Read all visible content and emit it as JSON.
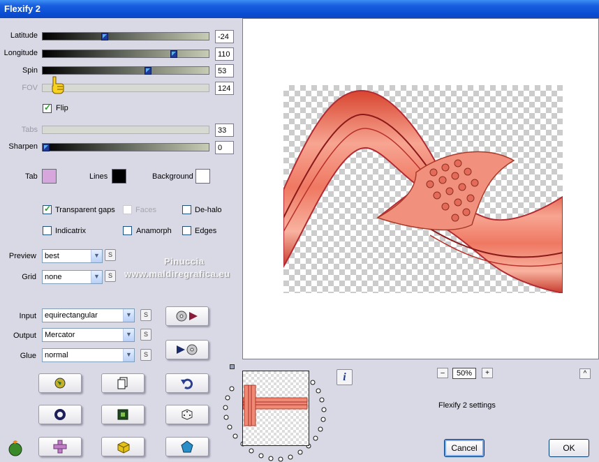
{
  "window": {
    "title": "Flexify 2"
  },
  "sliders": [
    {
      "label": "Latitude",
      "value": "-24",
      "thumb_pct": 0.37,
      "enabled": true
    },
    {
      "label": "Longitude",
      "value": "110",
      "thumb_pct": 0.78,
      "enabled": true
    },
    {
      "label": "Spin",
      "value": "53",
      "thumb_pct": 0.62,
      "enabled": true
    },
    {
      "label": "FOV",
      "value": "124",
      "thumb_pct": 0.05,
      "enabled": false
    }
  ],
  "flip": {
    "label": "Flip",
    "checked": true
  },
  "tabs_slider": {
    "label": "Tabs",
    "value": "33",
    "enabled": false
  },
  "sharpen_slider": {
    "label": "Sharpen",
    "value": "0",
    "thumb_pct": 0.0
  },
  "colors": {
    "tab": {
      "label": "Tab",
      "color": "#d6a6dc"
    },
    "lines": {
      "label": "Lines",
      "color": "#000000"
    },
    "background": {
      "label": "Background",
      "color": "#ffffff"
    }
  },
  "options": {
    "transparent_gaps": {
      "label": "Transparent gaps",
      "checked": true
    },
    "faces": {
      "label": "Faces",
      "checked": false
    },
    "de_halo": {
      "label": "De-halo",
      "checked": false
    },
    "indicatrix": {
      "label": "Indicatrix",
      "checked": false
    },
    "anamorph": {
      "label": "Anamorph",
      "checked": false
    },
    "edges": {
      "label": "Edges",
      "checked": false
    }
  },
  "preview_select": {
    "label": "Preview",
    "value": "best"
  },
  "grid_select": {
    "label": "Grid",
    "value": "none"
  },
  "input_select": {
    "label": "Input",
    "value": "equirectangular"
  },
  "output_select": {
    "label": "Output",
    "value": "Mercator"
  },
  "glue_select": {
    "label": "Glue",
    "value": "normal"
  },
  "small_button_label": "S",
  "zoom": {
    "value": "50%",
    "minus": "–",
    "plus": "+"
  },
  "settings_label": "Flexify 2 settings",
  "collapse_label": "^",
  "buttons": {
    "cancel": "Cancel",
    "ok": "OK"
  },
  "watermark": {
    "line1": "Pinuccia",
    "line2": "www.maldiregrafica.eu"
  },
  "info_icon": "i"
}
